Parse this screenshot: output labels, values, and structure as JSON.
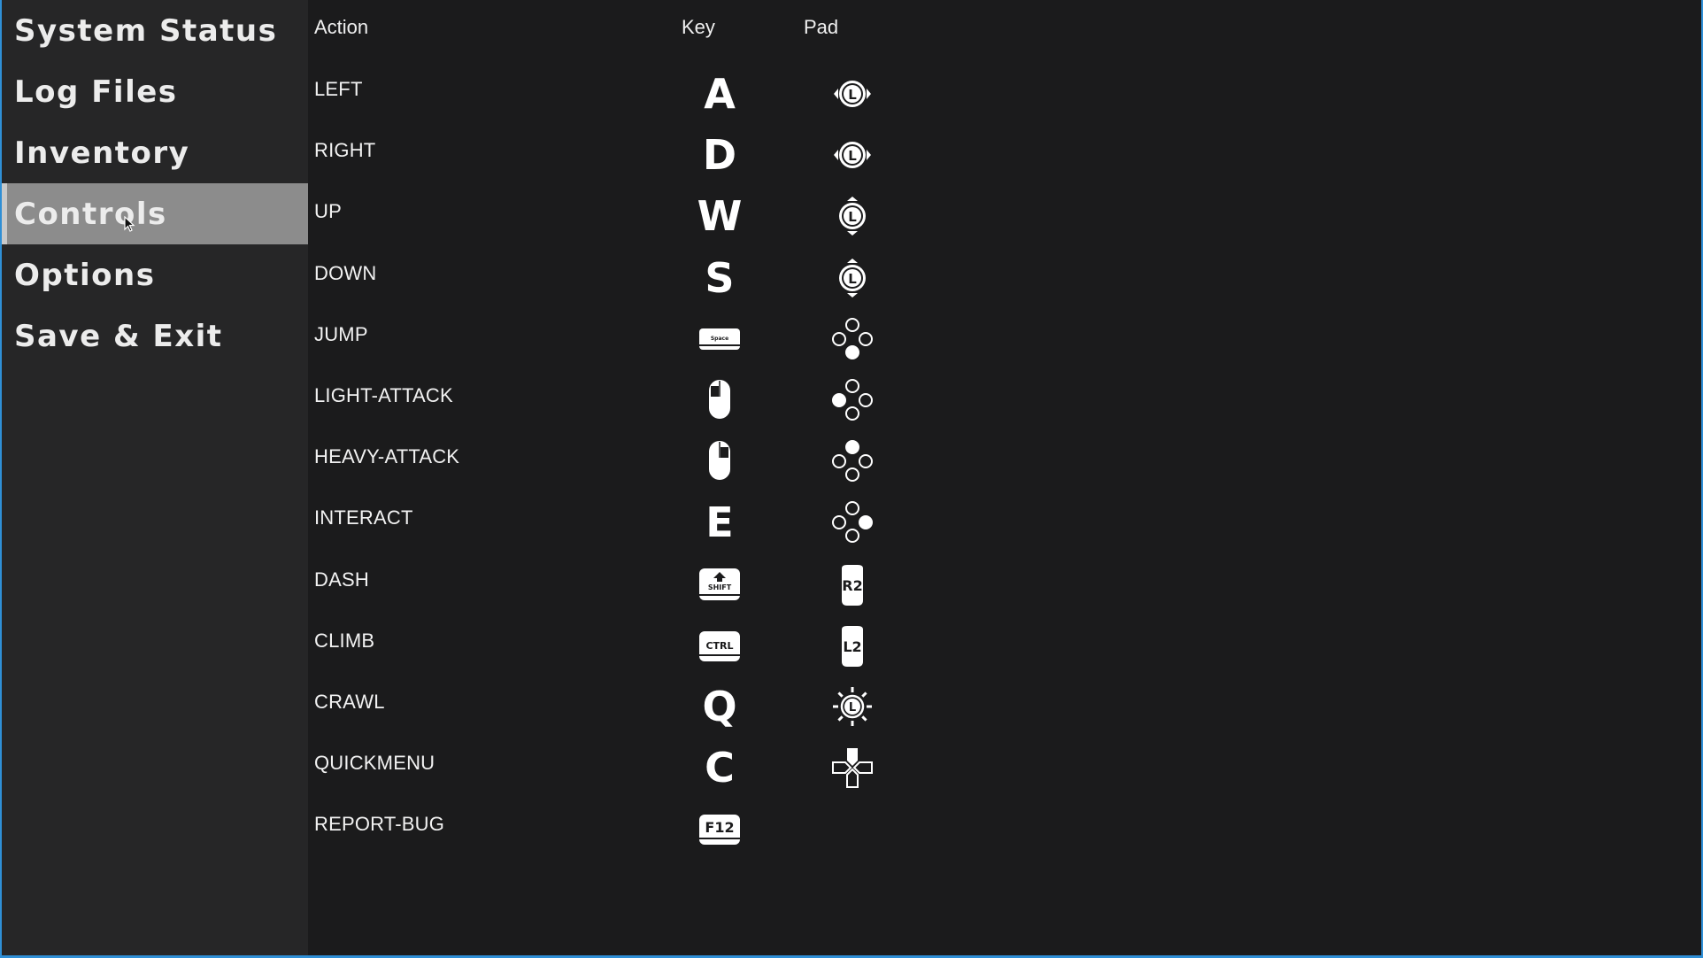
{
  "sidebar": {
    "items": [
      {
        "label": "System Status"
      },
      {
        "label": "Log Files"
      },
      {
        "label": "Inventory"
      },
      {
        "label": "Controls",
        "active": true
      },
      {
        "label": "Options"
      },
      {
        "label": "Save & Exit"
      }
    ]
  },
  "table": {
    "headers": {
      "action": "Action",
      "key": "Key",
      "pad": "Pad"
    },
    "rows": [
      {
        "action": "LEFT",
        "key": "A",
        "key_icon": "letter",
        "pad_icon": "left-stick-horizontal-icon"
      },
      {
        "action": "RIGHT",
        "key": "D",
        "key_icon": "letter",
        "pad_icon": "left-stick-horizontal-icon"
      },
      {
        "action": "UP",
        "key": "W",
        "key_icon": "letter",
        "pad_icon": "left-stick-vertical-icon"
      },
      {
        "action": "DOWN",
        "key": "S",
        "key_icon": "letter",
        "pad_icon": "left-stick-vertical-icon"
      },
      {
        "action": "JUMP",
        "key": "Space",
        "key_icon": "spacebar-icon",
        "pad_icon": "face-button-bottom-icon"
      },
      {
        "action": "LIGHT-ATTACK",
        "key": "",
        "key_icon": "mouse-left-click-icon",
        "pad_icon": "face-button-left-icon"
      },
      {
        "action": "HEAVY-ATTACK",
        "key": "",
        "key_icon": "mouse-right-click-icon",
        "pad_icon": "face-button-top-icon"
      },
      {
        "action": "INTERACT",
        "key": "E",
        "key_icon": "letter",
        "pad_icon": "face-button-right-icon"
      },
      {
        "action": "DASH",
        "key": "SHIFT",
        "key_icon": "shift-key-icon",
        "pad": "R2",
        "pad_icon": "r2-trigger-icon"
      },
      {
        "action": "CLIMB",
        "key": "CTRL",
        "key_icon": "ctrl-key-icon",
        "pad": "L2",
        "pad_icon": "l2-trigger-icon"
      },
      {
        "action": "CRAWL",
        "key": "Q",
        "key_icon": "letter",
        "pad_icon": "left-stick-press-icon"
      },
      {
        "action": "QUICKMENU",
        "key": "C",
        "key_icon": "letter",
        "pad_icon": "dpad-icon"
      },
      {
        "action": "REPORT-BUG",
        "key": "F12",
        "key_icon": "f12-key-icon",
        "pad_icon": ""
      }
    ]
  },
  "colors": {
    "background": "#1b1b1c",
    "sidebar": "#262627",
    "active_item": "#8c8c8c",
    "border": "#2f8fd6"
  }
}
